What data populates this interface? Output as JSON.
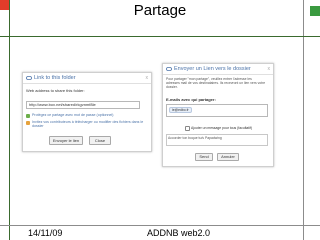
{
  "slide": {
    "title": "Partage",
    "footer_date": "14/11/09",
    "footer_title": "ADDNB web2.0"
  },
  "link_dialog": {
    "title": "Link to this folder",
    "close": "x",
    "web_label": "Web address to share this folder:",
    "url_value": "http://www.box.net/shared/rkgvnmf8le",
    "option1": "Protégez ce partage avec mot de passe (optionnel)",
    "option2": "Invitez vos contributeurs à télécharger ou modifier des fichiers dans le dossier",
    "send_button": "Envoyer le lien",
    "close_button": "Close"
  },
  "email_dialog": {
    "title": "Envoyer un Lien vers le dossier",
    "close": "x",
    "intro": "Pour partager \"mon partage\", veuillez entrer l'adresse les adresses mail de vos destinataires. Ils recevront un lien vers votre dossier.",
    "email_label": "E-mails avec qui partager:",
    "email_chip": "le@edbo.fr",
    "checkbox_label": "Ajouter un message pour tous (facultatif)",
    "message_text": "Accorder ton boque tu/s Papadwing",
    "send_button": "Send",
    "cancel_button": "Annuler"
  },
  "colors": {
    "accent_red": "#e23c2a",
    "accent_green": "#3a9a40",
    "link_blue": "#4a72a8"
  }
}
